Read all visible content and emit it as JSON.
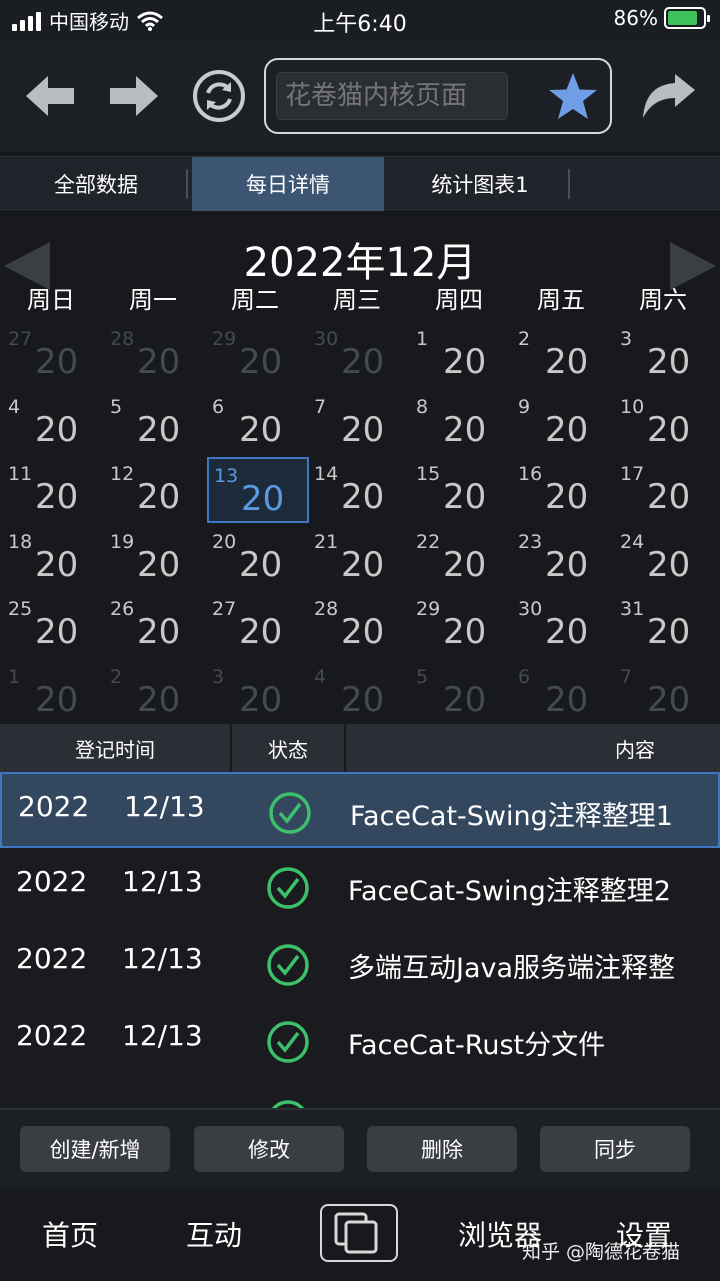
{
  "status": {
    "carrier": "中国移动",
    "time": "上午6:40",
    "battery": "86%",
    "battery_level": 0.86
  },
  "nav": {
    "url_placeholder": "花卷猫内核页面"
  },
  "tabs": [
    "全部数据",
    "每日详情",
    "统计图表1"
  ],
  "active_tab": 1,
  "calendar": {
    "title": "2022年12月",
    "weekdays": [
      "周日",
      "周一",
      "周二",
      "周三",
      "周四",
      "周五",
      "周六"
    ],
    "value": "20",
    "selected_day": "13"
  },
  "table": {
    "headers": [
      "登记时间",
      "状态",
      "内容"
    ],
    "rows": [
      {
        "year": "2022",
        "date": "12/13",
        "content": "FaceCat-Swing注释整理1"
      },
      {
        "year": "2022",
        "date": "12/13",
        "content": "FaceCat-Swing注释整理2"
      },
      {
        "year": "2022",
        "date": "12/13",
        "content": "多端互动Java服务端注释整"
      },
      {
        "year": "2022",
        "date": "12/13",
        "content": "FaceCat-Rust分文件"
      }
    ]
  },
  "actions": [
    "创建/新增",
    "修改",
    "删除",
    "同步"
  ],
  "bottom_nav": {
    "home": "首页",
    "interact": "互动",
    "browser": "浏览器",
    "settings": "设置"
  },
  "watermark": "知乎 @陶德花卷猫",
  "colors": {
    "accent": "#3f78c2",
    "check": "#3cc06a",
    "star": "#6f9de6",
    "selected_tab": "#3b5572"
  }
}
